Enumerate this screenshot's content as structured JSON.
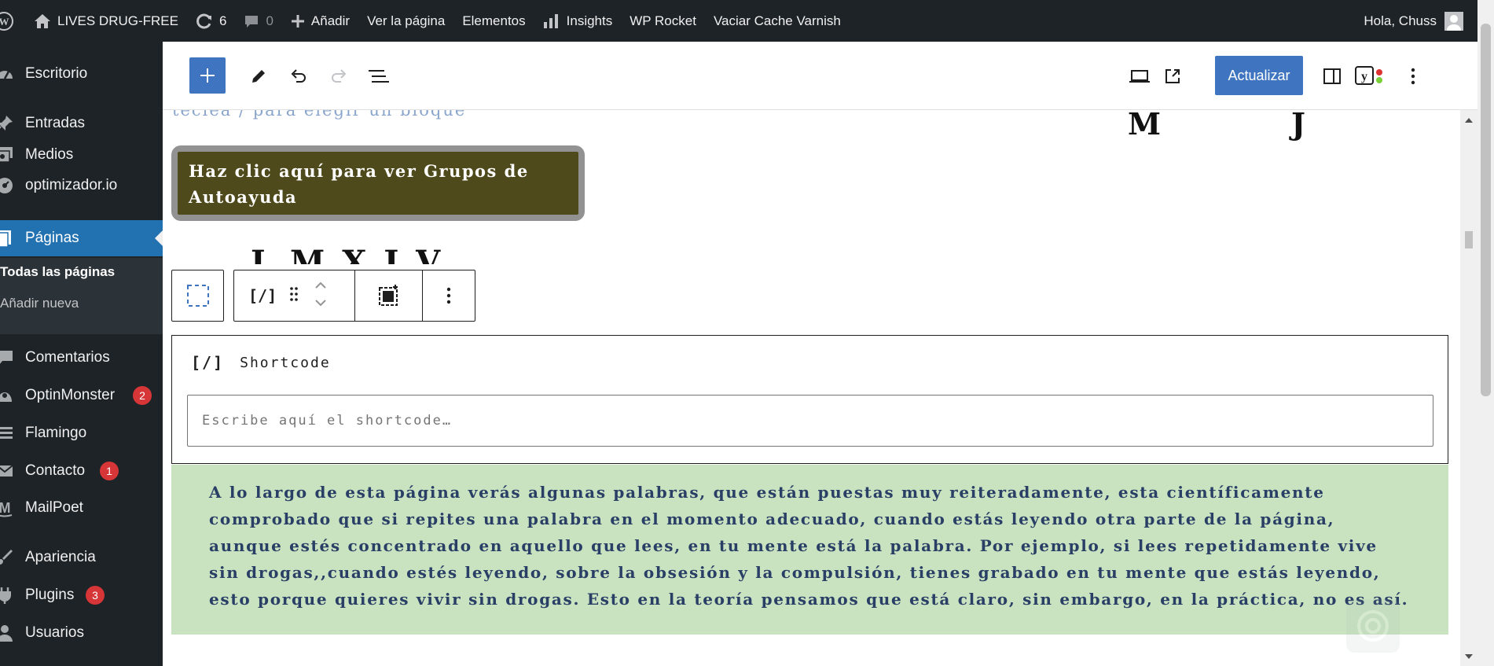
{
  "admin_bar": {
    "site_name": "LIVES DRUG-FREE",
    "updates_count": "6",
    "comments_count": "0",
    "add_new": "Añadir",
    "view_page": "Ver la página",
    "elements": "Elementos",
    "insights": "Insights",
    "wp_rocket": "WP Rocket",
    "varnish": "Vaciar Cache Varnish",
    "greeting": "Hola, Chuss"
  },
  "sidebar": {
    "items": [
      {
        "label": "Escritorio",
        "icon": "dashboard-icon"
      },
      {
        "label": "Entradas",
        "icon": "pin-icon"
      },
      {
        "label": "Medios",
        "icon": "media-icon"
      },
      {
        "label": "optimizador.io",
        "icon": "gauge-icon"
      },
      {
        "label": "Páginas",
        "icon": "pages-icon"
      },
      {
        "label": "Comentarios",
        "icon": "comment-icon"
      },
      {
        "label": "OptinMonster",
        "icon": "optinmonster-icon",
        "badge": "2"
      },
      {
        "label": "Flamingo",
        "icon": "flamingo-icon"
      },
      {
        "label": "Contacto",
        "icon": "mail-icon",
        "badge": "1"
      },
      {
        "label": "MailPoet",
        "icon": "mailpoet-icon"
      },
      {
        "label": "Apariencia",
        "icon": "brush-icon"
      },
      {
        "label": "Plugins",
        "icon": "plugin-icon",
        "badge": "3"
      },
      {
        "label": "Usuarios",
        "icon": "user-icon"
      }
    ],
    "submenu": {
      "all_pages": "Todas las páginas",
      "add_new": "Añadir nueva"
    }
  },
  "editor": {
    "update_label": "Actualizar",
    "placeholder_hint": "teclea / para elegir un bloque",
    "cut_letters_right": [
      "M",
      "J"
    ],
    "cut_letters_left": "L M X J V",
    "group_button_text": "Haz clic aquí para ver Grupos de Autoayuda",
    "shortcode": {
      "title": "Shortcode",
      "placeholder": "Escribe aquí el shortcode…"
    },
    "paragraph": " A lo largo de esta página verás algunas palabras, que están puestas muy reiteradamente, esta científicamente comprobado que si repites una palabra en el momento adecuado, cuando estás leyendo otra parte de la página, aunque estés concentrado en aquello que lees, en tu mente está la palabra. Por ejemplo, si lees repetidamente vive sin drogas,,cuando estés leyendo, sobre la obsesión y la compulsión, tienes grabado en tu mente que estás leyendo, esto porque quieres vivir sin drogas. Esto en la teoría pensamos que está claro, sin embargo, en la práctica, no es así."
  },
  "colors": {
    "admin_bg": "#1d2327",
    "accent": "#3e74c0",
    "group_button": "#4f4a1b",
    "paragraph_bg": "#c9e3c1",
    "badge": "#d63638"
  }
}
